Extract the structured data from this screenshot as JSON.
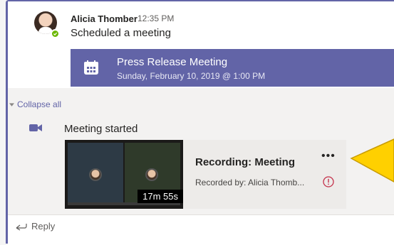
{
  "post": {
    "author": "Alicia Thomber",
    "time": "12:35 PM",
    "message": "Scheduled a meeting"
  },
  "meeting": {
    "title": "Press Release Meeting",
    "date": "Sunday, February 10, 2019 @ 1:00 PM"
  },
  "thread": {
    "collapse_label": "Collapse all",
    "event_text": "Meeting started"
  },
  "recording": {
    "title": "Recording: Meeting",
    "recorded_by": "Recorded by: Alicia Thomb...",
    "duration": "17m 55s",
    "more_label": "•••"
  },
  "reply": {
    "label": "Reply"
  },
  "colors": {
    "accent": "#6264a7",
    "presence": "#6bb700",
    "alert": "#c4314b",
    "callout": "#ffd000"
  },
  "icons": [
    "calendar-icon",
    "video-camera-icon",
    "reply-arrow-icon",
    "more-options-icon",
    "alert-icon",
    "available-presence-icon"
  ]
}
